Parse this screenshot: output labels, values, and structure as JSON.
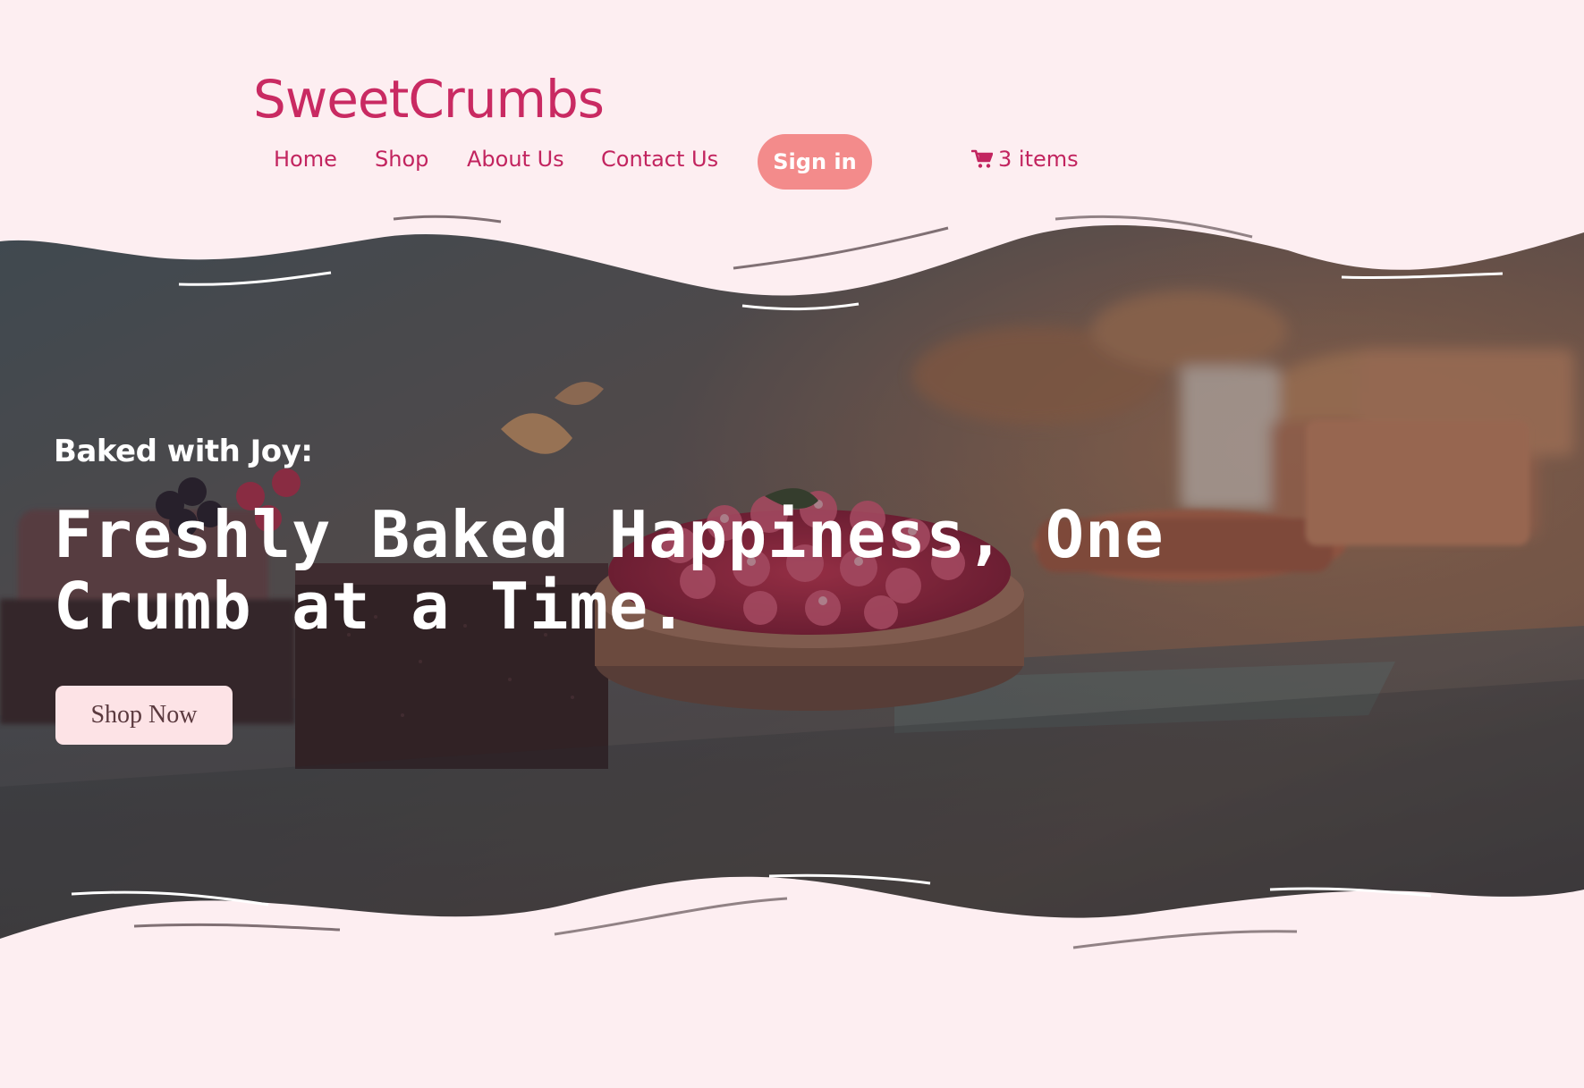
{
  "brand": {
    "name": "SweetCrumbs"
  },
  "nav": {
    "items": [
      {
        "label": "Home"
      },
      {
        "label": "Shop"
      },
      {
        "label": "About Us"
      },
      {
        "label": "Contact Us"
      }
    ],
    "signin_label": "Sign in",
    "cart_label": "3 items",
    "cart_icon": "shopping-cart-icon"
  },
  "hero": {
    "kicker": "Baked with Joy:",
    "headline": "Freshly Baked Happiness, One Crumb at a Time.",
    "cta_label": "Shop Now",
    "image": "bakery display case with raspberry tart and chocolate cakes"
  },
  "colors": {
    "background": "#fdeef1",
    "brand": "#c92a62",
    "nav_link": "#c2245f",
    "signin_button": "#f38b8b",
    "cta_button": "#fde3e6",
    "hero_overlay": "#3a3238"
  }
}
